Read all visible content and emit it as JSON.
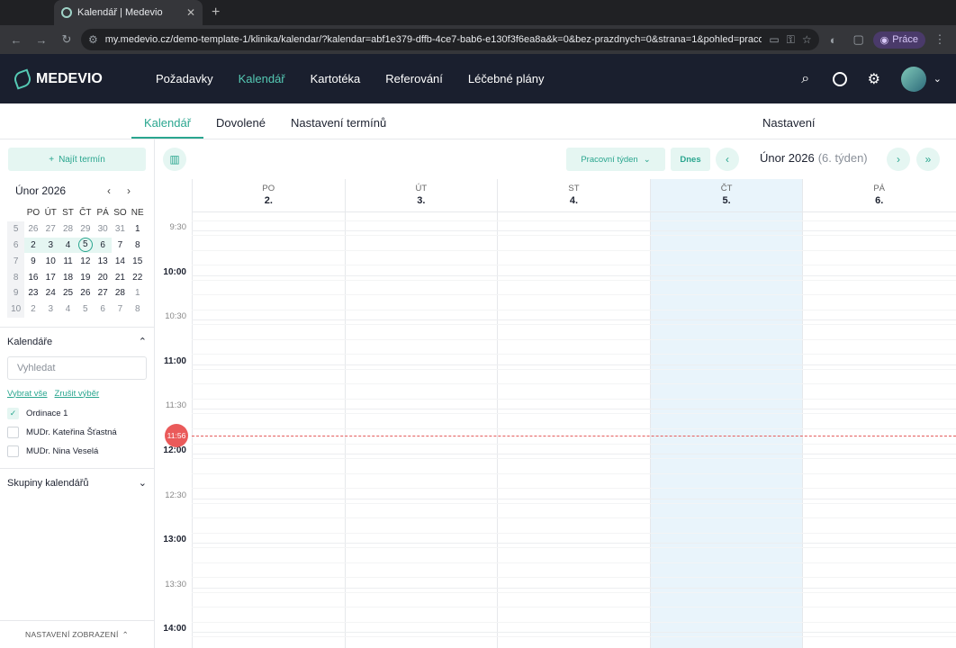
{
  "browser": {
    "tab_title": "Kalendář | Medevio",
    "url": "my.medevio.cz/demo-template-1/klinika/kalendar/?kalendar=abf1e379-dffb-4ce7-bab6-e130f3f6ea8a&k=0&bez-prazdnych=0&strana=1&pohled=pracovni-t...",
    "profile_label": "Práce"
  },
  "header": {
    "logo": "MEDEVIO",
    "nav": [
      "Požadavky",
      "Kalendář",
      "Kartotéka",
      "Referování",
      "Léčebné plány"
    ],
    "active_nav": "Kalendář"
  },
  "subnav": {
    "tabs": [
      "Kalendář",
      "Dovolené",
      "Nastavení termínů"
    ],
    "settings": "Nastavení"
  },
  "sidebar": {
    "find_button": "Najít termín",
    "month_title": "Únor 2026",
    "weekdays": [
      "PO",
      "ÚT",
      "ST",
      "ČT",
      "PÁ",
      "SO",
      "NE"
    ],
    "weeks": [
      {
        "wk": "5",
        "days": [
          "26",
          "27",
          "28",
          "29",
          "30",
          "31",
          "1"
        ]
      },
      {
        "wk": "6",
        "days": [
          "2",
          "3",
          "4",
          "5",
          "6",
          "7",
          "8"
        ]
      },
      {
        "wk": "7",
        "days": [
          "9",
          "10",
          "11",
          "12",
          "13",
          "14",
          "15"
        ]
      },
      {
        "wk": "8",
        "days": [
          "16",
          "17",
          "18",
          "19",
          "20",
          "21",
          "22"
        ]
      },
      {
        "wk": "9",
        "days": [
          "23",
          "24",
          "25",
          "26",
          "27",
          "28",
          "1"
        ]
      },
      {
        "wk": "10",
        "days": [
          "2",
          "3",
          "4",
          "5",
          "6",
          "7",
          "8"
        ]
      }
    ],
    "calendars_title": "Kalendáře",
    "search_placeholder": "Vyhledat",
    "select_all": "Vybrat vše",
    "clear_selection": "Zrušit výběr",
    "calendars": [
      {
        "name": "Ordinace 1",
        "checked": true
      },
      {
        "name": "MUDr. Kateřina Šťastná",
        "checked": false
      },
      {
        "name": "MUDr. Nina Veselá",
        "checked": false
      }
    ],
    "groups_title": "Skupiny kalendářů",
    "display_settings": "NASTAVENÍ ZOBRAZENÍ"
  },
  "toolbar": {
    "view": "Pracovní týden",
    "today": "Dnes",
    "period": "Únor 2026",
    "week": "(6. týden)"
  },
  "calendar": {
    "days": [
      {
        "name": "PO",
        "date": "2."
      },
      {
        "name": "ÚT",
        "date": "3."
      },
      {
        "name": "ST",
        "date": "4."
      },
      {
        "name": "ČT",
        "date": "5."
      },
      {
        "name": "PÁ",
        "date": "6."
      }
    ],
    "today_index": 3,
    "time_labels": [
      "9:30",
      "10:00",
      "10:30",
      "11:00",
      "11:30",
      "12:00",
      "12:30",
      "13:00",
      "13:30",
      "14:00"
    ],
    "now_label": "11:56"
  }
}
